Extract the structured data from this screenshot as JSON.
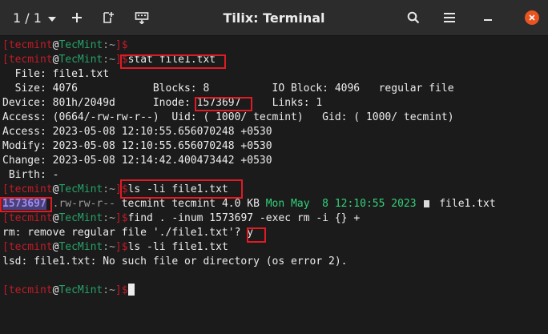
{
  "header": {
    "session": "1 / 1",
    "title": "Tilix: Terminal"
  },
  "prompt": {
    "open": "[",
    "user": "tecmint",
    "at": "@",
    "host": "TecMint",
    "path": ":~",
    "close": "]$"
  },
  "terminal": {
    "cmd_stat": "stat file1.txt",
    "stat_file": "  File: file1.txt",
    "stat_size": "  Size: 4076            Blocks: 8          IO Block: 4096   regular file",
    "stat_device_a": "Device: 801h/2049d      Inode: ",
    "stat_inode": "1573697",
    "stat_device_b": "     Links: 1",
    "stat_access_perm": "Access: (0664/-rw-rw-r--)  Uid: ( 1000/ tecmint)   Gid: ( 1000/ tecmint)",
    "stat_access_time": "Access: 2023-05-08 12:10:55.656070248 +0530",
    "stat_modify": "Modify: 2023-05-08 12:10:55.656070248 +0530",
    "stat_change": "Change: 2023-05-08 12:14:42.400473442 +0530",
    "stat_birth": " Birth: -",
    "cmd_ls1": "ls -li file1.txt",
    "ls_inode": "1573697",
    "ls_perm": " .rw-rw-r-- ",
    "ls_owner": "tecmint tecmint 4.0 KB ",
    "ls_date": "Mon May  8 12:10:55 2023",
    "ls_name": " file1.txt",
    "cmd_find": "find . -inum 1573697 -exec rm -i {} +",
    "rm_prompt": "rm: remove regular file './file1.txt'? ",
    "rm_answer": "y",
    "cmd_ls2": "ls -li file1.txt",
    "lsd_error": "lsd: file1.txt: No such file or directory (os error 2)."
  }
}
